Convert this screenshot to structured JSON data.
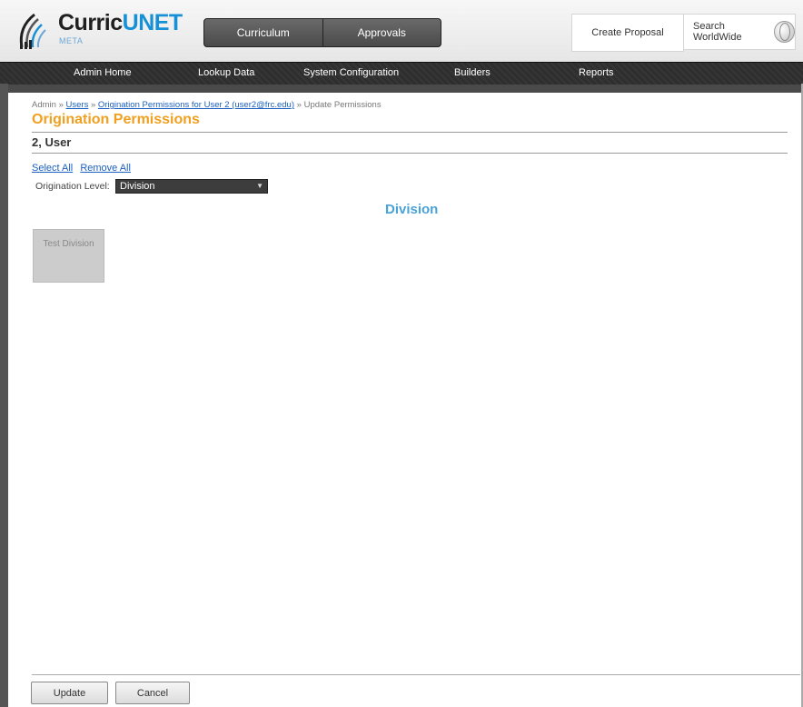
{
  "brand": {
    "name_part1": "Curric",
    "name_part2": "UNET",
    "subtitle": "META"
  },
  "top_tabs": [
    "Curriculum",
    "Approvals"
  ],
  "top_right": {
    "create": "Create Proposal",
    "search": "Search WorldWide"
  },
  "menu": [
    "Admin Home",
    "Lookup Data",
    "System Configuration",
    "Builders",
    "Reports"
  ],
  "breadcrumb": {
    "root": "Admin",
    "sep": "»",
    "users": "Users",
    "origination": "Origination Permissions for User 2 (user2@frc.edu)",
    "current": "Update Permissions"
  },
  "page_title": "Origination Permissions",
  "user_name": "2, User",
  "links": {
    "select_all": "Select All",
    "remove_all": "Remove All"
  },
  "origination": {
    "label": "Origination Level:",
    "selected": "Division"
  },
  "section_title": "Division",
  "tiles": [
    "Test Division"
  ],
  "buttons": {
    "update": "Update",
    "cancel": "Cancel"
  }
}
